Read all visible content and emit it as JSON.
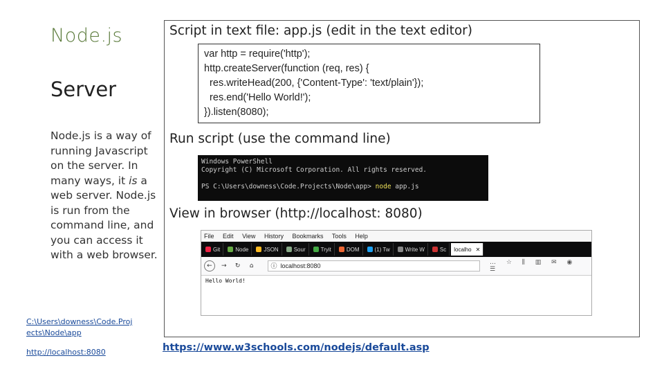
{
  "sidebar": {
    "subtitle": "Node.js",
    "title": "Server",
    "description_pre": "Node.js is a way of running Javascript on the server. In many ways, it ",
    "description_em": "is",
    "description_post": " a web server. Node.js is run from the command line, and you can access it with a web browser.",
    "path_link": "C:\\Users\\downess\\Code.Projects\\Node\\app",
    "localhost_link": "http://localhost:8080"
  },
  "panel": {
    "script_heading": "Script in text file: app.js (edit in the text editor)",
    "code_lines": [
      "var http = require('http');",
      "http.createServer(function (req, res) {",
      "  res.writeHead(200, {'Content-Type': 'text/plain'});",
      "  res.end('Hello World!');",
      "}).listen(8080);"
    ],
    "run_heading": "Run script (use the command line)",
    "shell": {
      "line1": "Windows PowerShell",
      "line2": "Copyright (C) Microsoft Corporation. All rights reserved.",
      "prompt": "PS C:\\Users\\downess\\Code.Projects\\Node\\app> ",
      "command": "node",
      "arg": " app.js"
    },
    "view_heading": "View in browser (http://localhost: 8080)",
    "browser": {
      "menu": [
        "File",
        "Edit",
        "View",
        "History",
        "Bookmarks",
        "Tools",
        "Help"
      ],
      "tabs": [
        "Git",
        "Node",
        "JSON",
        "Sour",
        "Tryit",
        "DOM",
        "(1) Tw",
        "Write W",
        "Sc",
        "localho"
      ],
      "url": "localhost:8080",
      "body_text": "Hello World!"
    }
  },
  "footer_link": "https://www.w3schools.com/nodejs/default.asp",
  "colors": {
    "subtitle": "#5a7a3a",
    "link": "#1a4a9a",
    "shell_bg": "#0c0c0c",
    "command": "#f0e35a"
  }
}
